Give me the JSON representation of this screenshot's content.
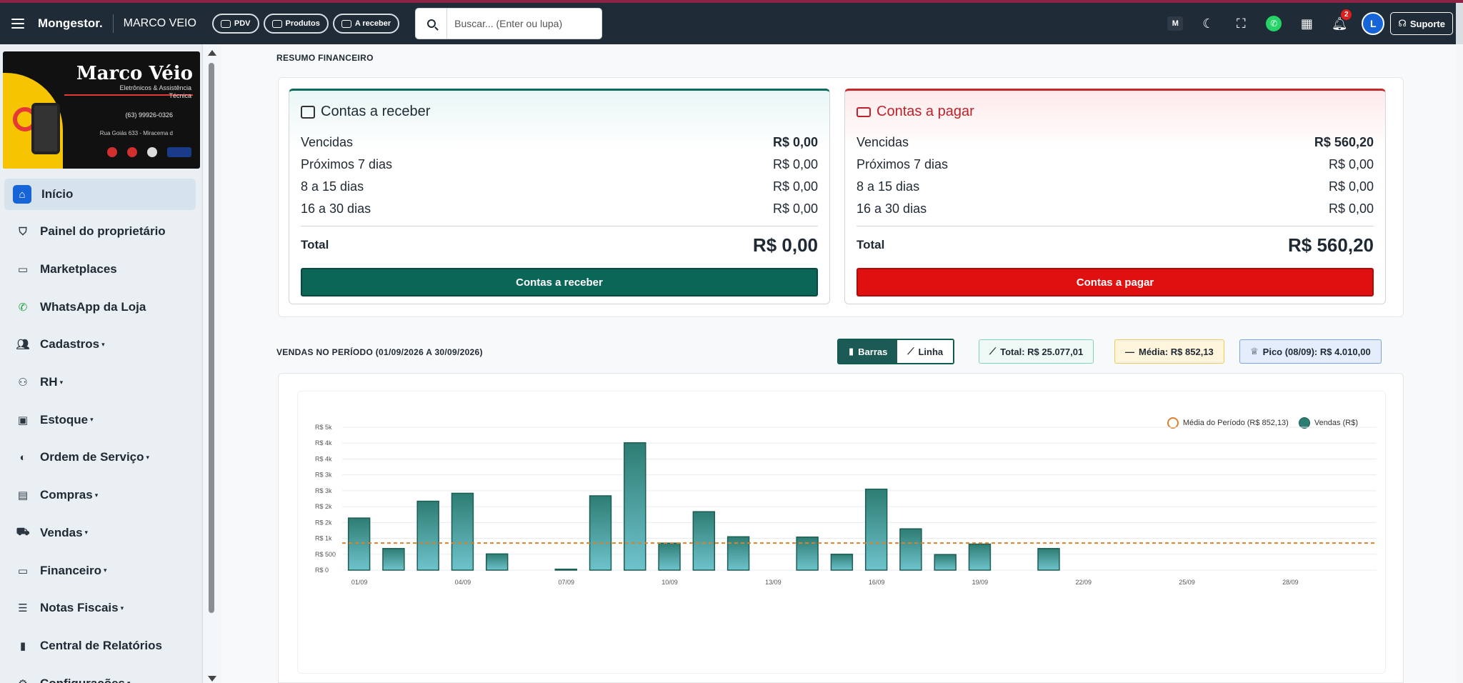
{
  "header": {
    "brand": "Mongestor.",
    "store": "MARCO VEIO",
    "pills": [
      "PDV",
      "Produtos",
      "A receber"
    ],
    "search_placeholder": "Buscar... (Enter ou lupa)",
    "notification_count": "2",
    "avatar_letter": "L",
    "support_label": "Suporte",
    "m_label": "M"
  },
  "logo": {
    "title": "Marco Véio",
    "subtitle": "Eletrônicos & Assistência Técnica",
    "phone": "(63) 99926-0326",
    "address": "Rua Goiás 633 - Miracema d"
  },
  "sidebar": {
    "items": [
      {
        "label": "Início",
        "icon": "home-icon",
        "dropdown": false
      },
      {
        "label": "Painel do proprietário",
        "icon": "shield-icon",
        "dropdown": false
      },
      {
        "label": "Marketplaces",
        "icon": "store-icon",
        "dropdown": false
      },
      {
        "label": "WhatsApp da Loja",
        "icon": "whatsapp-icon",
        "dropdown": false
      },
      {
        "label": "Cadastros",
        "icon": "users-icon",
        "dropdown": true
      },
      {
        "label": "RH",
        "icon": "people-icon",
        "dropdown": true
      },
      {
        "label": "Estoque",
        "icon": "box-icon",
        "dropdown": true
      },
      {
        "label": "Ordem de Serviço",
        "icon": "service-icon",
        "dropdown": true
      },
      {
        "label": "Compras",
        "icon": "bag-icon",
        "dropdown": true
      },
      {
        "label": "Vendas",
        "icon": "cart-icon",
        "dropdown": true
      },
      {
        "label": "Financeiro",
        "icon": "money-icon",
        "dropdown": true
      },
      {
        "label": "Notas Fiscais",
        "icon": "document-icon",
        "dropdown": true
      },
      {
        "label": "Central de Relatórios",
        "icon": "bar-chart-icon",
        "dropdown": false
      },
      {
        "label": "Configurações",
        "icon": "gear-icon",
        "dropdown": true
      }
    ]
  },
  "summary": {
    "section_title": "RESUMO FINANCEIRO",
    "receivable": {
      "title": "Contas a receber",
      "rows": [
        {
          "label": "Vencidas",
          "value": "R$ 0,00"
        },
        {
          "label": "Próximos 7 dias",
          "value": "R$ 0,00"
        },
        {
          "label": "8 a 15 dias",
          "value": "R$ 0,00"
        },
        {
          "label": "16 a 30 dias",
          "value": "R$ 0,00"
        }
      ],
      "total_label": "Total",
      "total_value": "R$ 0,00",
      "button": "Contas a receber"
    },
    "payable": {
      "title": "Contas a pagar",
      "rows": [
        {
          "label": "Vencidas",
          "value": "R$ 560,20"
        },
        {
          "label": "Próximos 7 dias",
          "value": "R$ 0,00"
        },
        {
          "label": "8 a 15 dias",
          "value": "R$ 0,00"
        },
        {
          "label": "16 a 30 dias",
          "value": "R$ 0,00"
        }
      ],
      "total_label": "Total",
      "total_value": "R$ 560,20",
      "button": "Contas a pagar"
    }
  },
  "sales": {
    "section_title": "VENDAS NO PERÍODO (01/09/2026 A 30/09/2026)",
    "toggle_bars": "Barras",
    "toggle_line": "Linha",
    "stat_total": "Total: R$ 25.077,01",
    "stat_avg": "Média: R$ 852,13",
    "stat_peak": "Pico (08/09): R$ 4.010,00"
  },
  "chart_data": {
    "type": "bar",
    "x": [
      "01/09",
      "02/09",
      "03/09",
      "04/09",
      "05/09",
      "06/09",
      "07/09",
      "08/09",
      "09/09",
      "10/09",
      "11/09",
      "12/09",
      "13/09",
      "14/09",
      "15/09",
      "16/09",
      "17/09",
      "18/09",
      "19/09",
      "20/09",
      "21/09",
      "22/09",
      "23/09",
      "24/09",
      "25/09",
      "26/09",
      "27/09",
      "28/09",
      "29/09",
      "30/09"
    ],
    "x_tick_labels": [
      "01/09",
      "04/09",
      "07/09",
      "10/09",
      "13/09",
      "16/09",
      "19/09",
      "22/09",
      "25/09",
      "28/09"
    ],
    "y_tick_labels": [
      "R$ 0",
      "R$ 500",
      "R$ 1k",
      "R$ 2k",
      "R$ 2k",
      "R$ 3k",
      "R$ 3k",
      "R$ 4k",
      "R$ 4k",
      "R$ 5k"
    ],
    "ylim": [
      0,
      4500
    ],
    "series": [
      {
        "name": "Vendas (R$)",
        "values": [
          1640,
          680,
          2170,
          2420,
          510,
          0,
          30,
          2340,
          4010,
          850,
          1840,
          1050,
          0,
          1040,
          500,
          2550,
          1300,
          490,
          820,
          0,
          680,
          0,
          0,
          0,
          0,
          0,
          0,
          0,
          0,
          0
        ]
      },
      {
        "name": "Média do Período (R$ 852,13)",
        "values": [
          852.13
        ]
      }
    ],
    "grid": true,
    "legend_position": "top-right",
    "colors": {
      "bar": "#2e7d73",
      "bar_fill_bottom": "#6ec3cc",
      "average": "#d9822b"
    }
  }
}
